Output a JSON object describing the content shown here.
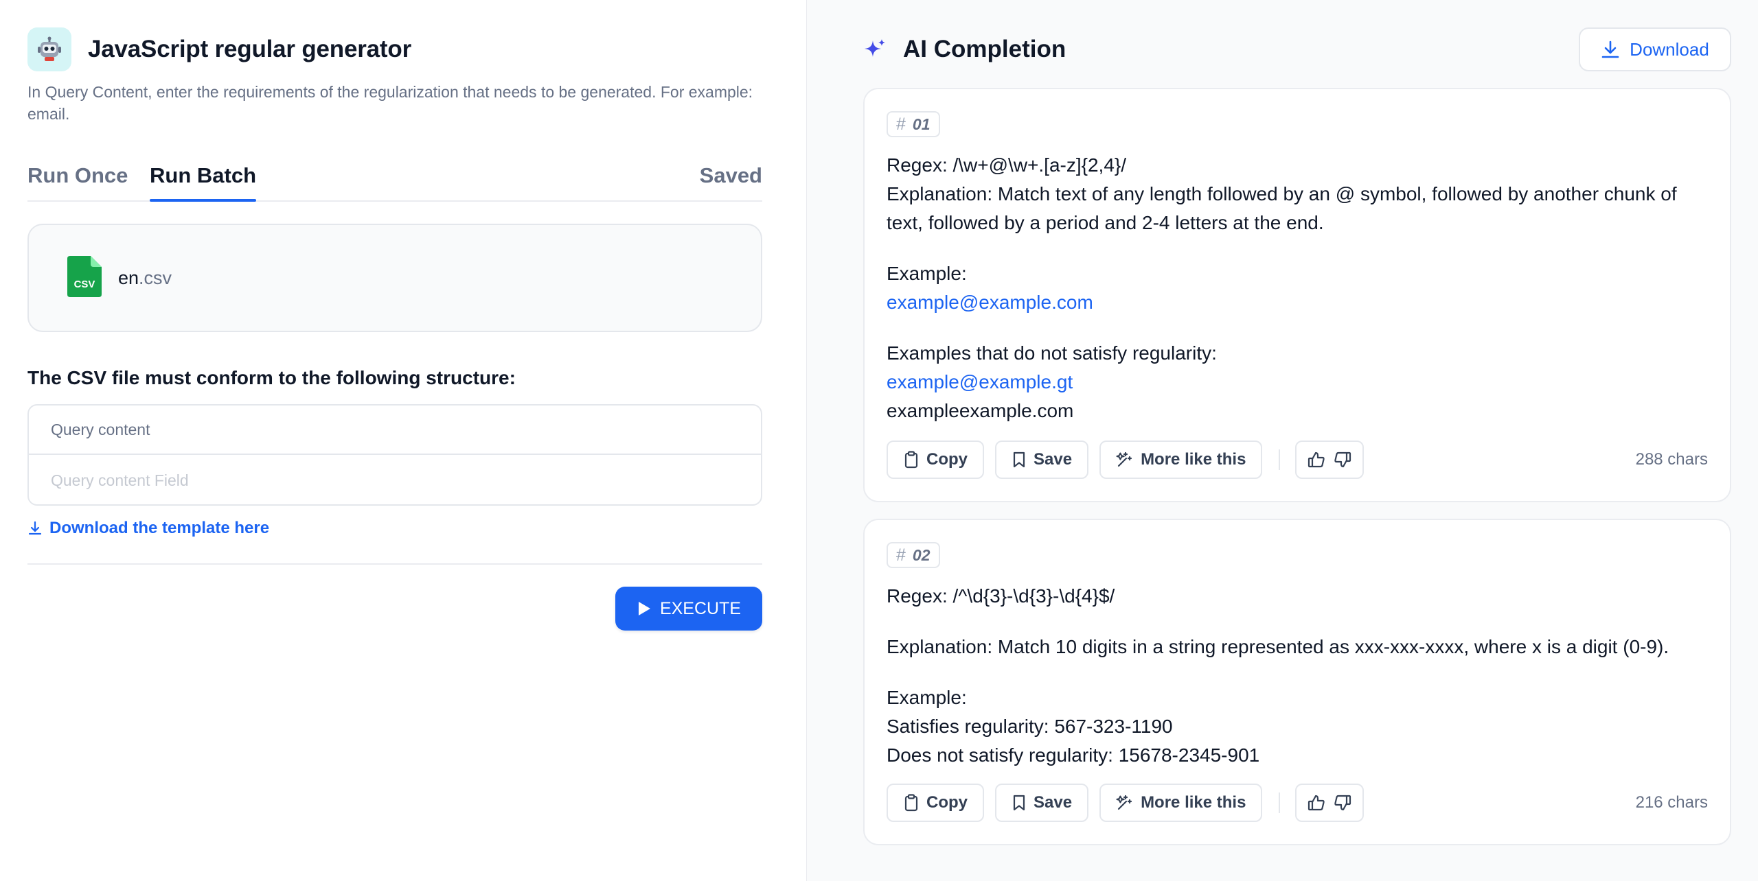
{
  "left": {
    "app_icon": "robot-icon",
    "title": "JavaScript regular generator",
    "description": "In Query Content, enter the requirements of the regularization that needs to be generated. For example: email.",
    "tabs": {
      "run_once": "Run Once",
      "run_batch": "Run Batch",
      "saved": "Saved"
    },
    "file": {
      "name": "en",
      "ext": ".csv",
      "icon": "csv-file-icon",
      "icon_label": "CSV"
    },
    "structure_note": "The CSV file must conform to the following structure:",
    "structure_table": {
      "header": "Query content",
      "row_placeholder": "Query content Field"
    },
    "download_template": "Download the template here",
    "execute_label": "EXECUTE"
  },
  "right": {
    "title": "AI Completion",
    "download_label": "Download",
    "results": [
      {
        "index": "01",
        "lines": {
          "regex": "Regex: /\\w+@\\w+.[a-z]{2,4}/",
          "explanation": "Explanation: Match text of any length followed by an @ symbol, followed by another chunk of text, followed by a period and 2-4 letters at the end.",
          "example_head": "Example:",
          "example_1": "example@example.com",
          "nonmatch_head": "Examples that do not satisfy regularity:",
          "nonmatch_1": "example@example.gt",
          "nonmatch_2": "exampleexample.com"
        },
        "chars": "288 chars"
      },
      {
        "index": "02",
        "lines": {
          "regex": "Regex: /^\\d{3}-\\d{3}-\\d{4}$/",
          "explanation": "Explanation: Match 10 digits in a string represented as xxx-xxx-xxxx, where x is a digit (0-9).",
          "example_head": "Example:",
          "satisfies": "Satisfies regularity: 567-323-1190",
          "not_satisfies": "Does not satisfy regularity: 15678-2345-901"
        },
        "chars": "216 chars"
      }
    ],
    "actions": {
      "copy": "Copy",
      "save": "Save",
      "more": "More like this"
    }
  },
  "colors": {
    "accent": "#1c64f2",
    "csv_green": "#16a34a",
    "sparkle": "#444ce7"
  }
}
